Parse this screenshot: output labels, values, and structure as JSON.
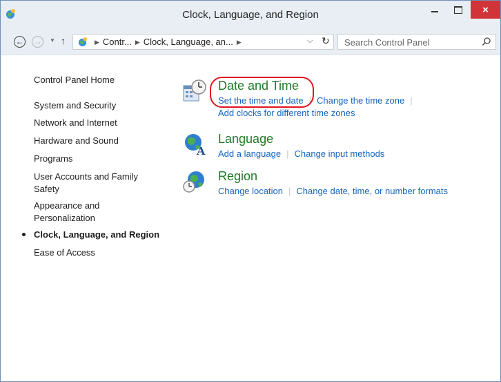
{
  "window": {
    "title": "Clock, Language, and Region",
    "close_label": "×"
  },
  "nav": {
    "breadcrumbs": [
      "Contr...",
      "Clock, Language, an..."
    ],
    "search_placeholder": "Search Control Panel"
  },
  "sidebar": {
    "items": [
      {
        "label": "Control Panel Home"
      },
      {
        "label": "System and Security"
      },
      {
        "label": "Network and Internet"
      },
      {
        "label": "Hardware and Sound"
      },
      {
        "label": "Programs"
      },
      {
        "label": "User Accounts and Family"
      },
      {
        "label": "Safety"
      },
      {
        "label": "Appearance and"
      },
      {
        "label": "Personalization"
      },
      {
        "label": "Clock, Language, and Region",
        "current": true
      },
      {
        "label": "Ease of Access"
      }
    ]
  },
  "categories": [
    {
      "title": "Date and Time",
      "links": [
        "Set the time and date",
        "Change the time zone"
      ],
      "links2": "Add clocks for different time zones",
      "icon": "date-time-icon"
    },
    {
      "title": "Language",
      "links": [
        "Add a language",
        "Change input methods"
      ],
      "icon": "language-icon"
    },
    {
      "title": "Region",
      "links": [
        "Change location",
        "Change date, time, or number formats"
      ],
      "icon": "region-icon"
    }
  ],
  "colors": {
    "category_title": "#1e7a27",
    "link": "#1565c0",
    "highlight": "#e0141e",
    "close_button": "#d13438"
  }
}
